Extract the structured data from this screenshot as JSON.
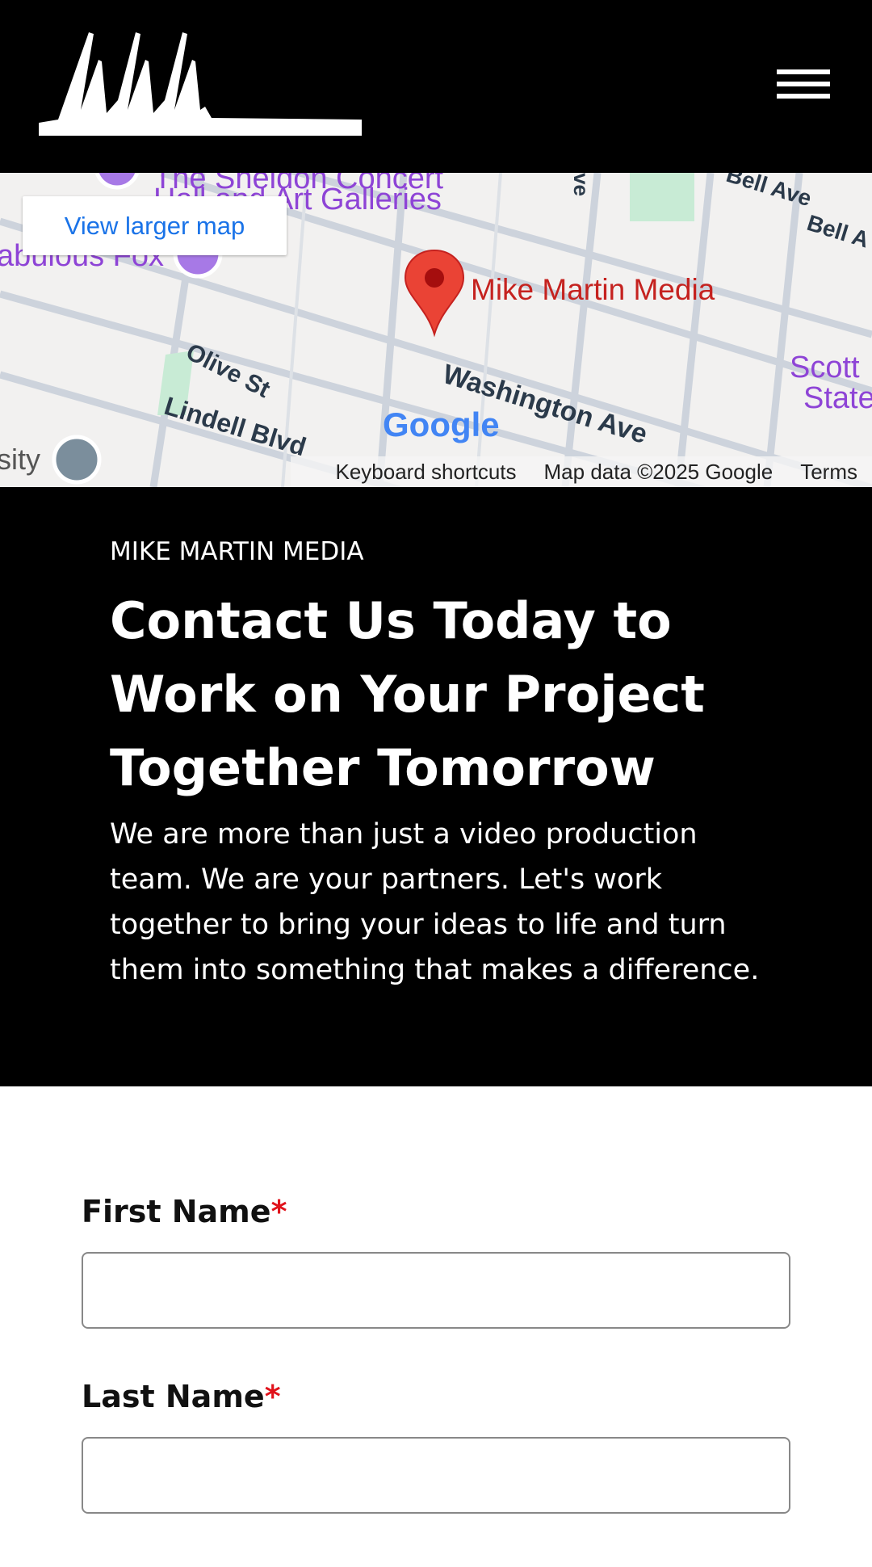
{
  "header": {
    "logo_text": "MMM",
    "menu_icon": "hamburger-icon"
  },
  "map": {
    "view_larger": "View larger map",
    "place_name": "Mike Martin Media",
    "streets": [
      "Washington Ave",
      "Olive St",
      "Lindell Blvd",
      "Bell Ave",
      "Bell A",
      "ve"
    ],
    "pois": [
      "The Sheldon Concert",
      "Hall and Art Galleries",
      "abulous Fox",
      "Scott",
      "State",
      "sity"
    ],
    "google_logo": "Google",
    "attribution": {
      "shortcuts": "Keyboard shortcuts",
      "data": "Map data ©2025 Google",
      "terms": "Terms"
    },
    "colors": {
      "pin": "#ea4335",
      "place_label": "#c5221f",
      "poi": "#8e44d6",
      "link": "#1a73e8"
    }
  },
  "contact": {
    "eyebrow": "MIKE MARTIN MEDIA",
    "heading": "Contact Us Today to Work on Your Project Together Tomorrow",
    "paragraph": "We are more than just a video production team. We are your partners. Let's work together to bring your ideas to life and turn them into something that makes a difference."
  },
  "form": {
    "first_name": {
      "label": "First Name",
      "required": "*",
      "value": ""
    },
    "last_name": {
      "label": "Last Name",
      "required": "*",
      "value": ""
    }
  }
}
